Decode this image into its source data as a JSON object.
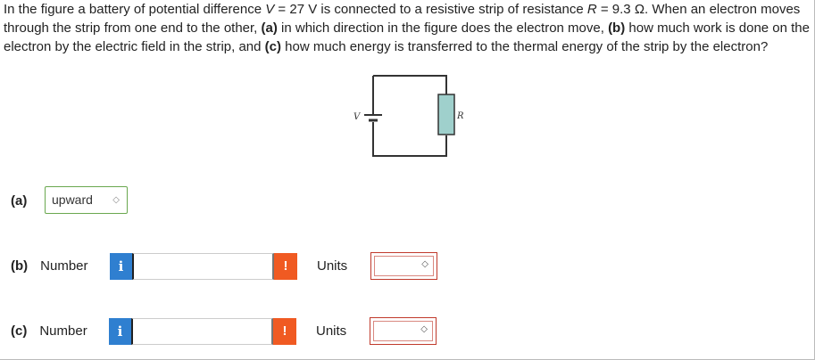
{
  "question": {
    "t1": "In the figure a battery of potential difference ",
    "v_sym": "V",
    "t2": " = 27 V is connected to a resistive strip of resistance ",
    "r_sym": "R",
    "t3": " = 9.3 Ω. When an electron moves through the strip from one end to the other, ",
    "a_tag": "(a)",
    "t4": " in which direction in the figure does the electron move, ",
    "b_tag": "(b)",
    "t5": " how much work is done on the electron by the electric field in the strip, and ",
    "c_tag": "(c)",
    "t6": " how much energy is transferred to the thermal energy of the strip by the electron?"
  },
  "figure": {
    "battery_label": "V",
    "resistor_label": "R",
    "wire_color": "#333333",
    "resistor_fill": "#9fd0cc"
  },
  "part_a": {
    "label": "(a)",
    "selected": "upward"
  },
  "part_b": {
    "label": "(b)",
    "number_text": "Number",
    "info": "i",
    "warn": "!",
    "number_value": "",
    "units_text": "Units",
    "units_value": ""
  },
  "part_c": {
    "label": "(c)",
    "number_text": "Number",
    "info": "i",
    "warn": "!",
    "number_value": "",
    "units_text": "Units",
    "units_value": ""
  },
  "colors": {
    "info": "#2f7fd0",
    "warn": "#f05a22",
    "units_border": "#c0392b",
    "select_border": "#6aa84f"
  },
  "icons": {
    "chevron": "chevron-updown-icon",
    "info": "info-icon",
    "warn": "exclamation-icon"
  }
}
